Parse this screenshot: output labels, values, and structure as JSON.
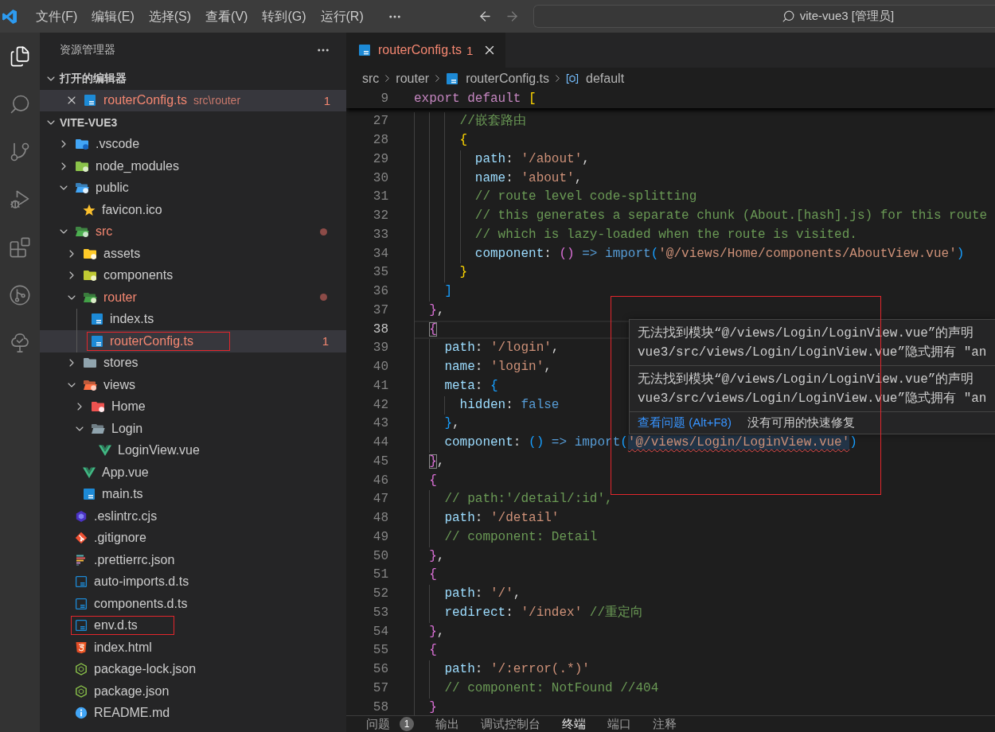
{
  "title_bar": {
    "menus": [
      {
        "label": "文件(F)"
      },
      {
        "label": "编辑(E)"
      },
      {
        "label": "选择(S)"
      },
      {
        "label": "查看(V)"
      },
      {
        "label": "转到(G)"
      },
      {
        "label": "运行(R)"
      }
    ],
    "navigation": [
      {
        "kind": "back",
        "disabled": false
      },
      {
        "kind": "forward",
        "disabled": true
      }
    ],
    "command_center": {
      "title": "vite-vue3 [管理员]"
    }
  },
  "activity_bar": [
    {
      "kind": "explorer",
      "selected": true
    },
    {
      "kind": "search",
      "selected": false
    },
    {
      "kind": "scm",
      "selected": false
    },
    {
      "kind": "debug",
      "selected": false
    },
    {
      "kind": "extensions",
      "selected": false
    },
    {
      "kind": "graph",
      "selected": false
    },
    {
      "kind": "tree",
      "selected": false
    }
  ],
  "sidebar": {
    "title": "资源管理器",
    "open_editors": {
      "title": "打开的编辑器",
      "expanded": true,
      "items": [
        {
          "name": "routerConfig.ts",
          "path": "src\\router",
          "kind": "ts",
          "error": true,
          "problems": "1",
          "selected": true
        }
      ]
    },
    "workspace": {
      "title": "VITE-VUE3",
      "expanded": true,
      "tree": [
        {
          "name": ".vscode",
          "kind": "vscode",
          "expanded": false,
          "error": false,
          "selected": false,
          "highlighted": false
        },
        {
          "name": "node_modules",
          "kind": "node",
          "expanded": false,
          "error": false,
          "selected": false,
          "highlighted": false
        },
        {
          "name": "public",
          "kind": "public",
          "expanded": true,
          "error": false,
          "selected": false,
          "highlighted": false,
          "children": [
            {
              "name": "favicon.ico",
              "kind": "star",
              "error": false,
              "selected": false,
              "highlighted": false
            }
          ]
        },
        {
          "name": "src",
          "kind": "src",
          "expanded": true,
          "error": true,
          "selected": false,
          "highlighted": false,
          "children": [
            {
              "name": "assets",
              "kind": "assets",
              "expanded": false,
              "error": false,
              "selected": false,
              "highlighted": false
            },
            {
              "name": "components",
              "kind": "components",
              "expanded": false,
              "error": false,
              "selected": false,
              "highlighted": false
            },
            {
              "name": "router",
              "kind": "router",
              "expanded": true,
              "error": true,
              "selected": false,
              "highlighted": false,
              "children": [
                {
                  "name": "index.ts",
                  "kind": "ts",
                  "error": false,
                  "selected": false,
                  "highlighted": false
                },
                {
                  "name": "routerConfig.ts",
                  "kind": "ts",
                  "error": true,
                  "problems": "1",
                  "selected": true,
                  "highlighted": true
                }
              ]
            },
            {
              "name": "stores",
              "kind": "plain",
              "expanded": false,
              "error": false,
              "selected": false,
              "highlighted": false
            },
            {
              "name": "views",
              "kind": "views",
              "expanded": true,
              "error": false,
              "selected": false,
              "highlighted": false,
              "children": [
                {
                  "name": "Home",
                  "kind": "home",
                  "expanded": false,
                  "error": false,
                  "selected": false,
                  "highlighted": false
                },
                {
                  "name": "Login",
                  "kind": "plain",
                  "expanded": true,
                  "error": false,
                  "selected": false,
                  "highlighted": false,
                  "children": [
                    {
                      "name": "LoginView.vue",
                      "kind": "vue",
                      "error": false,
                      "selected": false,
                      "highlighted": false
                    }
                  ]
                }
              ]
            },
            {
              "name": "App.vue",
              "kind": "vue",
              "error": false,
              "selected": false,
              "highlighted": false
            },
            {
              "name": "main.ts",
              "kind": "ts",
              "error": false,
              "selected": false,
              "highlighted": false
            }
          ]
        },
        {
          "name": ".eslintrc.cjs",
          "kind": "eslint",
          "error": false,
          "selected": false,
          "highlighted": false
        },
        {
          "name": ".gitignore",
          "kind": "git",
          "error": false,
          "selected": false,
          "highlighted": false
        },
        {
          "name": ".prettierrc.json",
          "kind": "prettier",
          "error": false,
          "selected": false,
          "highlighted": false
        },
        {
          "name": "auto-imports.d.ts",
          "kind": "dts",
          "error": false,
          "selected": false,
          "highlighted": false
        },
        {
          "name": "components.d.ts",
          "kind": "dts",
          "error": false,
          "selected": false,
          "highlighted": false
        },
        {
          "name": "env.d.ts",
          "kind": "dts",
          "error": false,
          "selected": false,
          "highlighted": true
        },
        {
          "name": "index.html",
          "kind": "html",
          "error": false,
          "selected": false,
          "highlighted": false
        },
        {
          "name": "package-lock.json",
          "kind": "json",
          "error": false,
          "selected": false,
          "highlighted": false
        },
        {
          "name": "package.json",
          "kind": "json",
          "error": false,
          "selected": false,
          "highlighted": false
        },
        {
          "name": "README.md",
          "kind": "readme",
          "error": false,
          "selected": false,
          "highlighted": false
        }
      ]
    }
  },
  "editor": {
    "tabs": [
      {
        "label": "routerConfig.ts",
        "kind": "ts",
        "error": true,
        "problems": "1",
        "selected": true
      }
    ],
    "breadcrumbs": [
      {
        "label": "src",
        "kind": "folder"
      },
      {
        "label": "router",
        "kind": "folder"
      },
      {
        "label": "routerConfig.ts",
        "kind": "ts"
      },
      {
        "label": "default",
        "kind": "symbol"
      }
    ],
    "sticky_line": {
      "number": "9",
      "tokens": [
        {
          "kind": "keyword",
          "text": "export default "
        },
        {
          "kind": "bracket1",
          "text": "["
        }
      ]
    },
    "lines": [
      {
        "number": "27",
        "current": false,
        "tokens": [
          {
            "kind": "comment",
            "text": "      //嵌套路由"
          }
        ]
      },
      {
        "number": "28",
        "current": false,
        "tokens": [
          {
            "kind": "bracket1",
            "text": "      {"
          }
        ]
      },
      {
        "number": "29",
        "current": false,
        "tokens": [
          {
            "kind": "property",
            "text": "        path"
          },
          {
            "kind": "plain",
            "text": ": "
          },
          {
            "kind": "string",
            "text": "'/about'"
          },
          {
            "kind": "plain",
            "text": ","
          }
        ]
      },
      {
        "number": "30",
        "current": false,
        "tokens": [
          {
            "kind": "property",
            "text": "        name"
          },
          {
            "kind": "plain",
            "text": ": "
          },
          {
            "kind": "string",
            "text": "'about'"
          },
          {
            "kind": "plain",
            "text": ","
          }
        ]
      },
      {
        "number": "31",
        "current": false,
        "tokens": [
          {
            "kind": "comment",
            "text": "        // route level code-splitting"
          }
        ]
      },
      {
        "number": "32",
        "current": false,
        "tokens": [
          {
            "kind": "comment",
            "text": "        // this generates a separate chunk (About.[hash].js) for this route"
          }
        ]
      },
      {
        "number": "33",
        "current": false,
        "tokens": [
          {
            "kind": "comment",
            "text": "        // which is lazy-loaded when the route is visited."
          }
        ]
      },
      {
        "number": "34",
        "current": false,
        "tokens": [
          {
            "kind": "property",
            "text": "        component"
          },
          {
            "kind": "plain",
            "text": ": "
          },
          {
            "kind": "bracket2",
            "text": "()"
          },
          {
            "kind": "storage",
            "text": " => import"
          },
          {
            "kind": "bracket3",
            "text": "("
          },
          {
            "kind": "string",
            "text": "'@/views/Home/components/AboutView.vue'"
          },
          {
            "kind": "bracket3",
            "text": ")"
          }
        ]
      },
      {
        "number": "35",
        "current": false,
        "tokens": [
          {
            "kind": "bracket1",
            "text": "      }"
          }
        ]
      },
      {
        "number": "36",
        "current": false,
        "tokens": [
          {
            "kind": "bracket3",
            "text": "    ]"
          }
        ]
      },
      {
        "number": "37",
        "current": false,
        "tokens": [
          {
            "kind": "bracket2",
            "text": "  }"
          },
          {
            "kind": "plain",
            "text": ","
          }
        ]
      },
      {
        "number": "38",
        "current": true,
        "tokens": [
          {
            "kind": "bracket2",
            "text": "  {",
            "matched": true
          }
        ]
      },
      {
        "number": "39",
        "current": false,
        "tokens": [
          {
            "kind": "property",
            "text": "    path"
          },
          {
            "kind": "plain",
            "text": ": "
          },
          {
            "kind": "string",
            "text": "'/login'"
          },
          {
            "kind": "plain",
            "text": ","
          }
        ]
      },
      {
        "number": "40",
        "current": false,
        "tokens": [
          {
            "kind": "property",
            "text": "    name"
          },
          {
            "kind": "plain",
            "text": ": "
          },
          {
            "kind": "string",
            "text": "'login'"
          },
          {
            "kind": "plain",
            "text": ","
          }
        ]
      },
      {
        "number": "41",
        "current": false,
        "tokens": [
          {
            "kind": "property",
            "text": "    meta"
          },
          {
            "kind": "plain",
            "text": ": "
          },
          {
            "kind": "bracket3",
            "text": "{"
          }
        ]
      },
      {
        "number": "42",
        "current": false,
        "tokens": [
          {
            "kind": "property",
            "text": "      hidden"
          },
          {
            "kind": "plain",
            "text": ": "
          },
          {
            "kind": "storage",
            "text": "false"
          }
        ]
      },
      {
        "number": "43",
        "current": false,
        "tokens": [
          {
            "kind": "bracket3",
            "text": "    }"
          },
          {
            "kind": "plain",
            "text": ","
          }
        ]
      },
      {
        "number": "44",
        "current": false,
        "tokens": [
          {
            "kind": "property",
            "text": "    component"
          },
          {
            "kind": "plain",
            "text": ": "
          },
          {
            "kind": "bracket3",
            "text": "()"
          },
          {
            "kind": "storage",
            "text": " => import"
          },
          {
            "kind": "bracket3",
            "text": "("
          },
          {
            "kind": "string",
            "text": "'@/views/Login/LoginView.vue'",
            "error": true
          },
          {
            "kind": "bracket3",
            "text": ")"
          }
        ]
      },
      {
        "number": "45",
        "current": false,
        "tokens": [
          {
            "kind": "bracket2",
            "text": "  }",
            "matched": true
          },
          {
            "kind": "plain",
            "text": ","
          }
        ]
      },
      {
        "number": "46",
        "current": false,
        "tokens": [
          {
            "kind": "bracket2",
            "text": "  {"
          }
        ]
      },
      {
        "number": "47",
        "current": false,
        "tokens": [
          {
            "kind": "comment",
            "text": "    // path:'/detail/:id',"
          }
        ]
      },
      {
        "number": "48",
        "current": false,
        "tokens": [
          {
            "kind": "property",
            "text": "    path"
          },
          {
            "kind": "plain",
            "text": ": "
          },
          {
            "kind": "string",
            "text": "'/detail'"
          }
        ]
      },
      {
        "number": "49",
        "current": false,
        "tokens": [
          {
            "kind": "comment",
            "text": "    // component: Detail"
          }
        ]
      },
      {
        "number": "50",
        "current": false,
        "tokens": [
          {
            "kind": "bracket2",
            "text": "  }"
          },
          {
            "kind": "plain",
            "text": ","
          }
        ]
      },
      {
        "number": "51",
        "current": false,
        "tokens": [
          {
            "kind": "bracket2",
            "text": "  {"
          }
        ]
      },
      {
        "number": "52",
        "current": false,
        "tokens": [
          {
            "kind": "property",
            "text": "    path"
          },
          {
            "kind": "plain",
            "text": ": "
          },
          {
            "kind": "string",
            "text": "'/'"
          },
          {
            "kind": "plain",
            "text": ","
          }
        ]
      },
      {
        "number": "53",
        "current": false,
        "tokens": [
          {
            "kind": "property",
            "text": "    redirect"
          },
          {
            "kind": "plain",
            "text": ": "
          },
          {
            "kind": "string",
            "text": "'/index'"
          },
          {
            "kind": "comment",
            "text": " //重定向"
          }
        ]
      },
      {
        "number": "54",
        "current": false,
        "tokens": [
          {
            "kind": "bracket2",
            "text": "  }"
          },
          {
            "kind": "plain",
            "text": ","
          }
        ]
      },
      {
        "number": "55",
        "current": false,
        "tokens": [
          {
            "kind": "bracket2",
            "text": "  {"
          }
        ]
      },
      {
        "number": "56",
        "current": false,
        "tokens": [
          {
            "kind": "property",
            "text": "    path"
          },
          {
            "kind": "plain",
            "text": ": "
          },
          {
            "kind": "string",
            "text": "'/:error(.*)'"
          }
        ]
      },
      {
        "number": "57",
        "current": false,
        "tokens": [
          {
            "kind": "comment",
            "text": "    // component: NotFound //404"
          }
        ]
      },
      {
        "number": "58",
        "current": false,
        "tokens": [
          {
            "kind": "bracket2",
            "text": "  }"
          }
        ]
      }
    ],
    "hover": {
      "highlighted": true,
      "messages": [
        {
          "lines": [
            "无法找到模块“@/views/Login/LoginView.vue”的声明",
            "vue3/src/views/Login/LoginView.vue”隐式拥有 \"an"
          ]
        },
        {
          "lines": [
            "无法找到模块“@/views/Login/LoginView.vue”的声明",
            "vue3/src/views/Login/LoginView.vue”隐式拥有 \"an"
          ]
        }
      ],
      "actions": [
        {
          "kind": "link",
          "label": "查看问题 (Alt+F8)"
        },
        {
          "kind": "note",
          "label": "没有可用的快速修复"
        }
      ]
    }
  },
  "panel": {
    "tabs": [
      {
        "label": "问题",
        "badge": "1",
        "selected": false
      },
      {
        "label": "输出",
        "selected": false
      },
      {
        "label": "调试控制台",
        "selected": false
      },
      {
        "label": "终端",
        "selected": true
      },
      {
        "label": "端口",
        "selected": false
      },
      {
        "label": "注释",
        "selected": false
      }
    ]
  }
}
